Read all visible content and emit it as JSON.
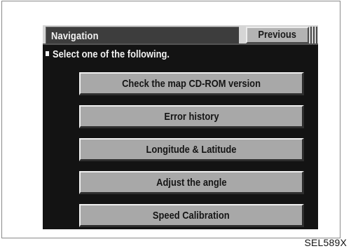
{
  "header": {
    "title": "Navigation",
    "previous_label": "Previous"
  },
  "instruction": "Select one of the following.",
  "menu": {
    "items": [
      {
        "label": "Check the map CD-ROM version"
      },
      {
        "label": "Error history"
      },
      {
        "label": "Longitude & Latitude"
      },
      {
        "label": "Adjust the angle"
      },
      {
        "label": "Speed Calibration"
      }
    ]
  },
  "figure_code": "SEL589X"
}
